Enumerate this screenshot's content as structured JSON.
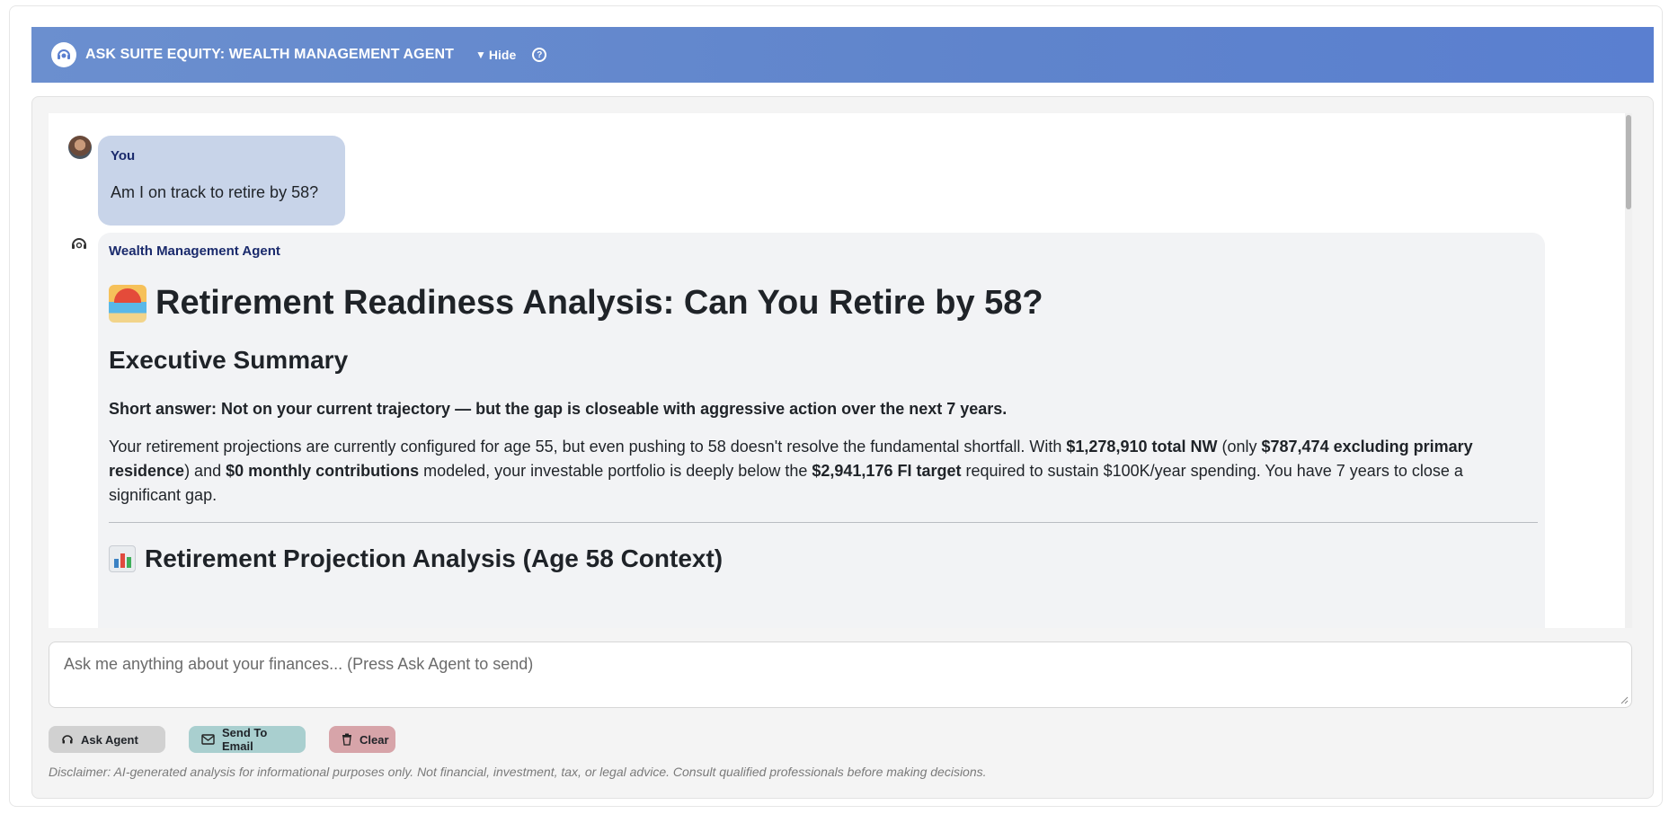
{
  "header": {
    "title": "ASK SUITE EQUITY: WEALTH MANAGEMENT AGENT",
    "hide_label": "Hide",
    "hide_triangle": "▼",
    "help_glyph": "?"
  },
  "chat": {
    "user_message": {
      "sender": "You",
      "text": "Am I on track to retire by 58?"
    },
    "agent_message": {
      "sender": "Wealth Management Agent",
      "title": "Retirement Readiness Analysis: Can You Retire by 58?",
      "exec_summary_heading": "Executive Summary",
      "short_answer": "Short answer: Not on your current trajectory — but the gap is closeable with aggressive action over the next 7 years.",
      "para": {
        "p1": "Your retirement projections are currently configured for age 55, but even pushing to 58 doesn't resolve the fundamental shortfall. With ",
        "b1": "$1,278,910 total NW",
        "p2": " (only ",
        "b2": "$787,474 excluding primary residence",
        "p3": ") and ",
        "b3": "$0 monthly contributions",
        "p4": " modeled, your investable portfolio is deeply below the ",
        "b4": "$2,941,176 FI target",
        "p5": " required to sustain $100K/year spending. You have 7 years to close a significant gap."
      },
      "projection_heading": "Retirement Projection Analysis (Age 58 Context)"
    }
  },
  "input": {
    "placeholder": "Ask me anything about your finances... (Press Ask Agent to send)"
  },
  "buttons": {
    "ask_label": "Ask Agent",
    "email_label": "Send To Email",
    "clear_label": "Clear"
  },
  "disclaimer": "Disclaimer: AI-generated analysis for informational purposes only. Not financial, investment, tax, or legal advice. Consult qualified professionals before making decisions.",
  "colors": {
    "header_gradient_start": "#6b8fcf",
    "header_gradient_end": "#5a7fd0",
    "user_bubble": "#c8d4e9",
    "agent_bubble": "#f2f3f5",
    "sender_label": "#1a2a6c",
    "ask_button": "#d1d1d1",
    "email_button": "#a9cfcf",
    "clear_button": "#d7a4a9"
  },
  "icons": {
    "header": "agent-headset-icon",
    "help": "help-icon",
    "agent_avatar": "agent-headset-icon",
    "title_emoji": "beach-umbrella-icon",
    "projection_emoji": "bar-chart-icon",
    "ask": "headset-icon",
    "email": "mail-icon",
    "clear": "trash-icon"
  }
}
